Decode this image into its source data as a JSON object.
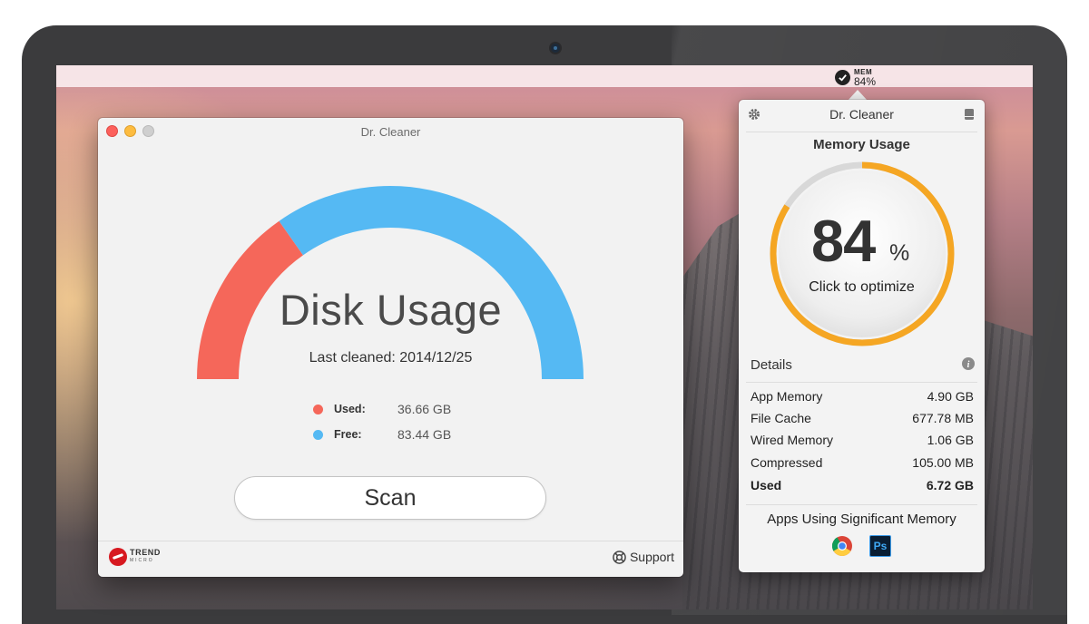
{
  "menubar": {
    "mem_label": "MEM",
    "mem_value": "84%"
  },
  "disk_window": {
    "title": "Dr. Cleaner",
    "heading": "Disk Usage",
    "last_cleaned": "Last cleaned: 2014/12/25",
    "used_label": "Used:",
    "used_value": "36.66 GB",
    "free_label": "Free:",
    "free_value": "83.44 GB",
    "used_fraction": 0.305,
    "scan_label": "Scan",
    "brand_top": "TREND",
    "brand_bottom": "MICRO",
    "support_label": "Support",
    "colors": {
      "used": "#f5675a",
      "free": "#55b9f3"
    }
  },
  "memory_popover": {
    "title": "Dr. Cleaner",
    "heading": "Memory Usage",
    "percent": "84",
    "percent_sign": "%",
    "percent_fraction": 0.84,
    "action": "Click to optimize",
    "details_label": "Details",
    "rows": [
      {
        "label": "App Memory",
        "value": "4.90 GB"
      },
      {
        "label": "File Cache",
        "value": "677.78 MB"
      },
      {
        "label": "Wired Memory",
        "value": "1.06 GB"
      },
      {
        "label": "Compressed",
        "value": "105.00 MB"
      },
      {
        "label": "Used",
        "value": "6.72 GB"
      }
    ],
    "apps_heading": "Apps Using Significant Memory",
    "apps": [
      {
        "icon": "chrome-icon"
      },
      {
        "icon": "photoshop-icon",
        "label": "Ps"
      }
    ],
    "colors": {
      "ring": "#f5a623",
      "track": "#d8d8d8"
    }
  }
}
